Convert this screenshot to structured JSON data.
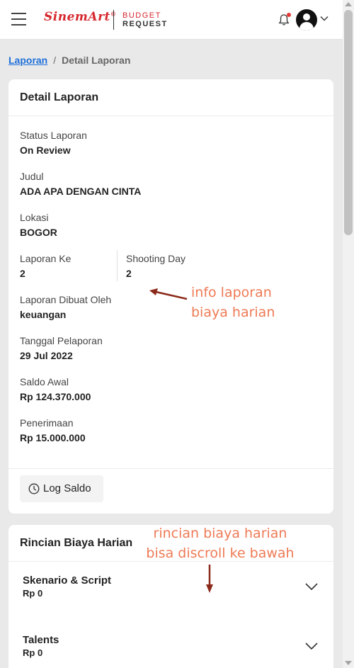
{
  "header": {
    "logo_script": "SinemArt",
    "logo_sup": "®",
    "logo_line1": "BUDGET",
    "logo_line2": "REQUEST",
    "icons": {
      "menu": "hamburger-menu-icon",
      "notification": "bell-icon",
      "profile": "user-avatar-icon",
      "profile_dropdown": "chevron-down-icon"
    },
    "accent_color": "#d6282e"
  },
  "breadcrumb": {
    "link": "Laporan",
    "separator": "/",
    "current": "Detail Laporan"
  },
  "detail_card": {
    "title": "Detail Laporan",
    "fields": {
      "status_label": "Status Laporan",
      "status_value": "On Review",
      "judul_label": "Judul",
      "judul_value": "ADA APA DENGAN CINTA",
      "lokasi_label": "Lokasi",
      "lokasi_value": "BOGOR",
      "laporan_ke_label": "Laporan Ke",
      "laporan_ke_value": "2",
      "shooting_day_label": "Shooting Day",
      "shooting_day_value": "2",
      "dibuat_oleh_label": "Laporan Dibuat Oleh",
      "dibuat_oleh_value": "keuangan",
      "tanggal_label": "Tanggal Pelaporan",
      "tanggal_value": "29 Jul 2022",
      "saldo_label": "Saldo Awal",
      "saldo_value": "Rp 124.370.000",
      "penerimaan_label": "Penerimaan",
      "penerimaan_value": "Rp 15.000.000"
    },
    "log_button": "Log Saldo"
  },
  "rincian_card": {
    "title": "Rincian Biaya Harian",
    "items": [
      {
        "title": "Skenario & Script",
        "amount": "Rp 0"
      },
      {
        "title": "Talents",
        "amount": "Rp 0"
      }
    ]
  },
  "annotations": {
    "info_line1": "info laporan",
    "info_line2": "biaya harian",
    "rincian_line1": "rincian biaya harian",
    "rincian_line2": "bisa discroll ke bawah",
    "annotation_color": "#ee7a55",
    "arrow_color": "#8b2a1a"
  }
}
